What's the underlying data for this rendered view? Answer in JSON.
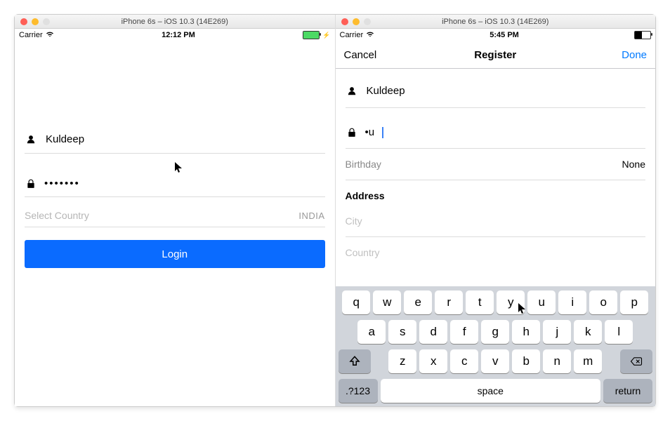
{
  "simLeft": {
    "windowTitle": "iPhone 6s – iOS 10.3 (14E269)",
    "carrier": "Carrier",
    "time": "12:12 PM",
    "usernameValue": "Kuldeep",
    "passwordMasked": "•••••••",
    "selectCountryLabel": "Select Country",
    "selectedCountry": "INDIA",
    "loginButton": "Login"
  },
  "simRight": {
    "windowTitle": "iPhone 6s – iOS 10.3 (14E269)",
    "carrier": "Carrier",
    "time": "5:45 PM",
    "navCancel": "Cancel",
    "navTitle": "Register",
    "navDone": "Done",
    "usernameValue": "Kuldeep",
    "passwordDisplay": "•u",
    "birthdayLabel": "Birthday",
    "birthdayValue": "None",
    "addressLabel": "Address",
    "cityPlaceholder": "City",
    "countryPlaceholder": "Country"
  },
  "keyboard": {
    "row1": [
      "q",
      "w",
      "e",
      "r",
      "t",
      "y",
      "u",
      "i",
      "o",
      "p"
    ],
    "row2": [
      "a",
      "s",
      "d",
      "f",
      "g",
      "h",
      "j",
      "k",
      "l"
    ],
    "row3": [
      "z",
      "x",
      "c",
      "v",
      "b",
      "n",
      "m"
    ],
    "numSym": ".?123",
    "space": "space",
    "return": "return"
  }
}
